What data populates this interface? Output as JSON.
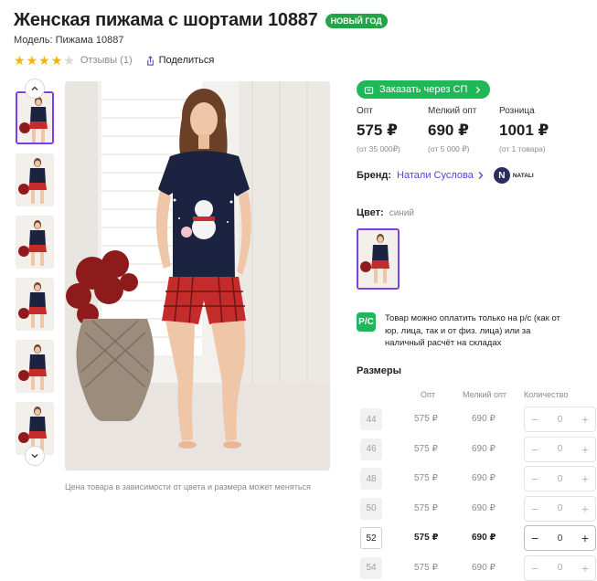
{
  "product": {
    "title": "Женская пижама с шортами 10887",
    "badge": "НОВЫЙ ГОД",
    "model": "Модель: Пижама 10887",
    "rating": 4,
    "reviews_label": "Отзывы (1)",
    "share_label": "Поделиться"
  },
  "photo_caption": "Цена товара в зависимости от цвета и размера может меняться",
  "order_button": "Заказать через СП",
  "prices": [
    {
      "label": "Опт",
      "value": "575 ₽",
      "note": "(от 35 000₽)"
    },
    {
      "label": "Мелкий опт",
      "value": "690 ₽",
      "note": "(от 5 000 ₽)"
    },
    {
      "label": "Розница",
      "value": "1001 ₽",
      "note": "(от 1 товара)"
    }
  ],
  "brand": {
    "key": "Бренд:",
    "name": "Натали Суслова",
    "logo_text": "NATALI",
    "logo_letter": "N"
  },
  "color": {
    "key": "Цвет:",
    "value": "синий"
  },
  "payment": {
    "icon_text": "Р/С",
    "text": "Товар можно оплатить только на р/с (как от юр. лица, так и от физ. лица) или за наличный расчёт на складах"
  },
  "sizes": {
    "title": "Размеры",
    "headers": {
      "opt": "Опт",
      "small_opt": "Мелкий опт",
      "qty": "Количество"
    },
    "rows": [
      {
        "size": "44",
        "opt": "575 ₽",
        "small_opt": "690 ₽",
        "qty": "0",
        "available": false
      },
      {
        "size": "46",
        "opt": "575 ₽",
        "small_opt": "690 ₽",
        "qty": "0",
        "available": false
      },
      {
        "size": "48",
        "opt": "575 ₽",
        "small_opt": "690 ₽",
        "qty": "0",
        "available": false
      },
      {
        "size": "50",
        "opt": "575 ₽",
        "small_opt": "690 ₽",
        "qty": "0",
        "available": false
      },
      {
        "size": "52",
        "opt": "575 ₽",
        "small_opt": "690 ₽",
        "qty": "0",
        "available": true
      },
      {
        "size": "54",
        "opt": "575 ₽",
        "small_opt": "690 ₽",
        "qty": "0",
        "available": false
      }
    ],
    "minus": "−",
    "plus": "+"
  },
  "colors": {
    "accent": "#7b3fe4",
    "green": "#1eb859",
    "badge_green": "#22a447",
    "star": "#f5b400",
    "shirt": "#1c2340",
    "shorts": "#c42b2b"
  }
}
